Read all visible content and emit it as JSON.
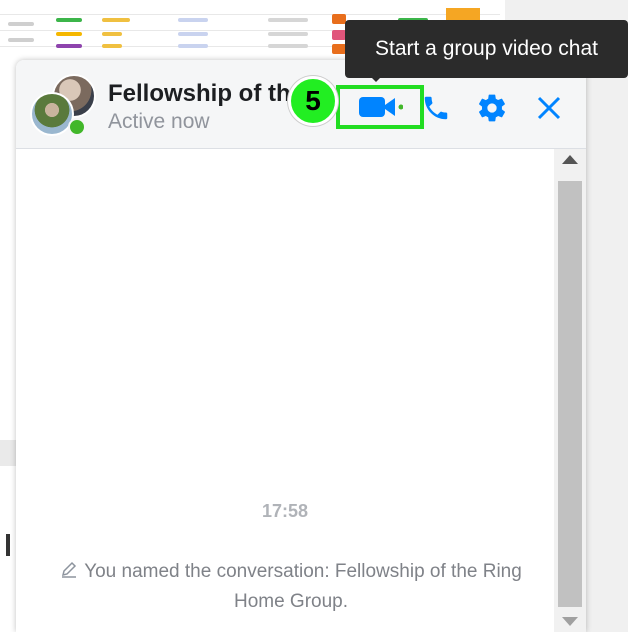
{
  "chat": {
    "title": "Fellowship of the Ring Home Group",
    "status": "Active now",
    "step_number": "5",
    "tooltip": "Start a group video chat",
    "timestamp": "17:58",
    "system_message": "You named the conversation: Fellowship of the Ring Home Group."
  },
  "icons": {
    "video": "video-camera-icon",
    "phone": "phone-icon",
    "settings": "gear-icon",
    "close": "close-icon",
    "edit": "pencil-icon"
  },
  "colors": {
    "accent": "#0084ff",
    "highlight": "#22dd22",
    "presence": "#42b72a",
    "tooltip_bg": "#2b2b2b"
  }
}
